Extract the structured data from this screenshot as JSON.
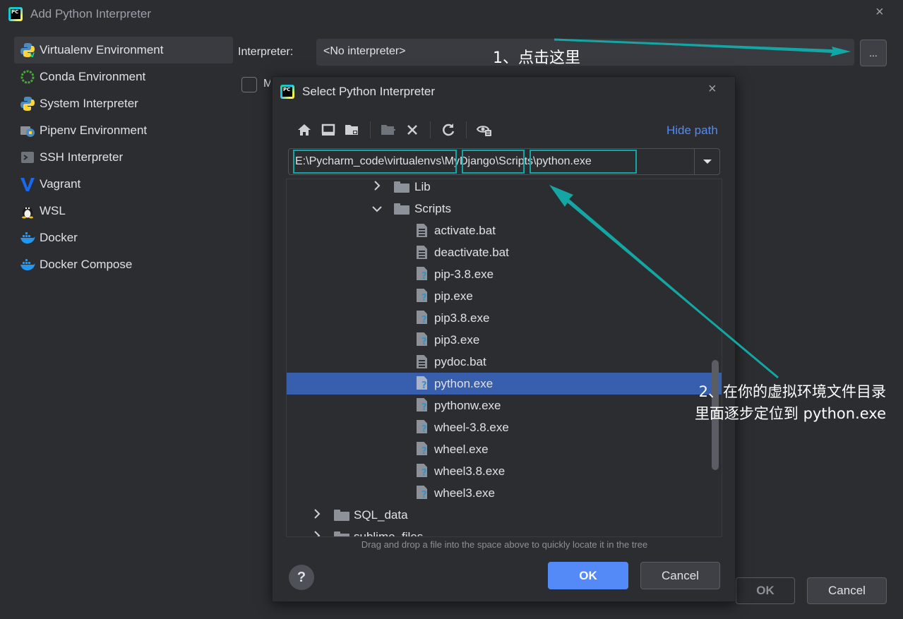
{
  "outer": {
    "title": "Add Python Interpreter",
    "close": "×",
    "sidebar": [
      {
        "label": "Virtualenv Environment",
        "icon": "python-virtualenv-icon"
      },
      {
        "label": "Conda Environment",
        "icon": "conda-icon"
      },
      {
        "label": "System Interpreter",
        "icon": "python-icon"
      },
      {
        "label": "Pipenv Environment",
        "icon": "pipenv-icon"
      },
      {
        "label": "SSH Interpreter",
        "icon": "ssh-icon"
      },
      {
        "label": "Vagrant",
        "icon": "vagrant-icon"
      },
      {
        "label": "WSL",
        "icon": "linux-penguin-icon"
      },
      {
        "label": "Docker",
        "icon": "docker-icon"
      },
      {
        "label": "Docker Compose",
        "icon": "docker-compose-icon"
      }
    ],
    "active_item": "Virtualenv Environment",
    "interpreter_label": "Interpreter:",
    "interpreter_value": "<No interpreter>",
    "browse_label": "...",
    "checkbox_label": "M",
    "ok_label": "OK",
    "cancel_label": "Cancel"
  },
  "inner": {
    "title": "Select Python Interpreter",
    "close": "×",
    "hide_path": "Hide path",
    "path_parts": [
      "E:\\Pycharm_code\\virtualenvs",
      "\\",
      "MyDjango",
      "\\",
      "Scripts\\python.exe"
    ],
    "tree": [
      {
        "label": "Lib",
        "type": "folder",
        "expanded": false
      },
      {
        "label": "Scripts",
        "type": "folder",
        "expanded": true
      },
      {
        "label": "activate.bat",
        "type": "file"
      },
      {
        "label": "deactivate.bat",
        "type": "file"
      },
      {
        "label": "pip-3.8.exe",
        "type": "exe"
      },
      {
        "label": "pip.exe",
        "type": "exe"
      },
      {
        "label": "pip3.8.exe",
        "type": "exe"
      },
      {
        "label": "pip3.exe",
        "type": "exe"
      },
      {
        "label": "pydoc.bat",
        "type": "file"
      },
      {
        "label": "python.exe",
        "type": "exe",
        "selected": true
      },
      {
        "label": "pythonw.exe",
        "type": "exe"
      },
      {
        "label": "wheel-3.8.exe",
        "type": "exe"
      },
      {
        "label": "wheel.exe",
        "type": "exe"
      },
      {
        "label": "wheel3.8.exe",
        "type": "exe"
      },
      {
        "label": "wheel3.exe",
        "type": "exe"
      },
      {
        "label": "SQL_data",
        "type": "folder",
        "expanded": false
      },
      {
        "label": "sublime_files",
        "type": "folder",
        "expanded": false
      }
    ],
    "drag_hint": "Drag and drop a file into the space above to quickly locate it in the tree",
    "help": "?",
    "ok_label": "OK",
    "cancel_label": "Cancel"
  },
  "annotations": {
    "step1": "1、点击这里",
    "step2_line1": "2、在你的虚拟环境文件目录",
    "step2_line2": "里面逐步定位到 python.exe"
  },
  "colors": {
    "background": "#2b2d30",
    "accent": "#548af7",
    "selection": "#375fad",
    "annotation": "#13a6a4"
  }
}
